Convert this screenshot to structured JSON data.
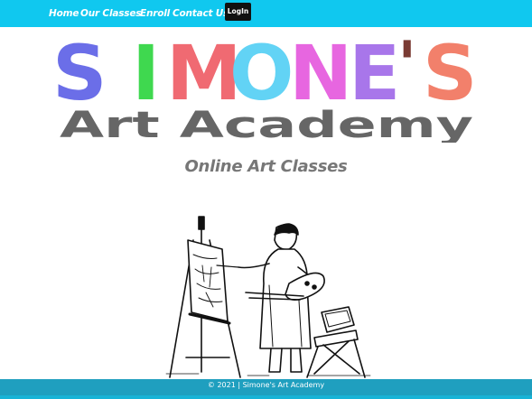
{
  "nav": {
    "home": "Home",
    "classes": "Our Classes",
    "enroll": "Enroll",
    "contact": "Contact Us",
    "login": "LogIn"
  },
  "logo": {
    "letters": [
      "S",
      "I",
      "M",
      "O",
      "N",
      "E",
      "'",
      "S"
    ],
    "letter_colors": [
      "#6b6ee8",
      "#3fd84f",
      "#f06a72",
      "#62d3f5",
      "#e766e0",
      "#a876ea",
      "#7a3b33",
      "#f2806b"
    ],
    "tagline": "Art Academy",
    "tagline_color": "#666666"
  },
  "subtitle": "Online Art Classes",
  "illustration": {
    "icon": "painter-at-easel-icon"
  },
  "footer": {
    "text": "© 2021 | Simone's Art Academy"
  },
  "colors": {
    "nav_bg": "#10c8ef",
    "login_bg": "#111111",
    "footer_bg": "#1f9fbf",
    "subtitle": "#777777"
  }
}
